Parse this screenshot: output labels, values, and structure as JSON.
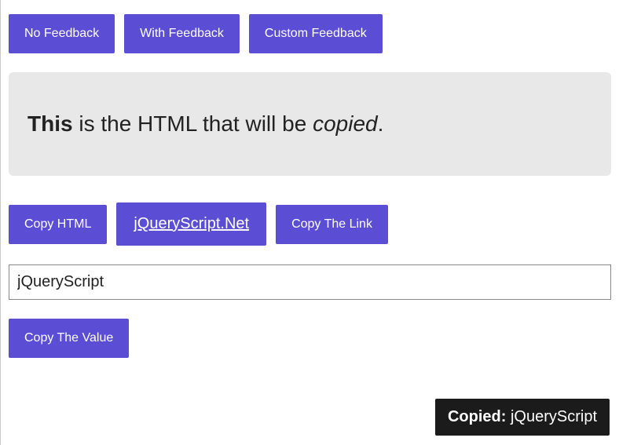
{
  "topButtons": {
    "noFeedback": "No Feedback",
    "withFeedback": "With Feedback",
    "customFeedback": "Custom Feedback"
  },
  "preview": {
    "strong": "This",
    "middle": " is the HTML that will be ",
    "em": "copied",
    "end": "."
  },
  "midButtons": {
    "copyHtml": "Copy HTML",
    "link": "jQueryScript.Net",
    "copyLink": "Copy The Link"
  },
  "input": {
    "value": "jQueryScript"
  },
  "bottomButtons": {
    "copyValue": "Copy The Value"
  },
  "toast": {
    "label": "Copied:",
    "value": "jQueryScript"
  }
}
